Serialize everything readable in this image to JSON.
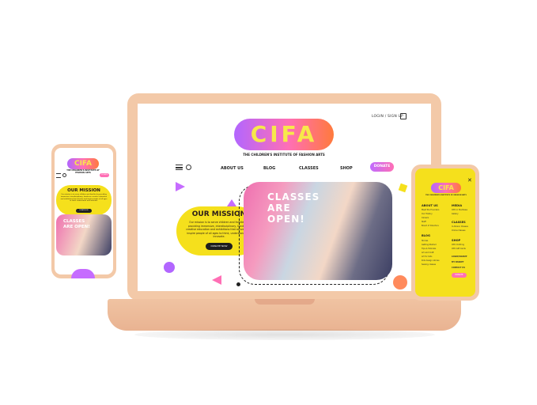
{
  "colors": {
    "accent_yellow": "#f5e01c",
    "accent_pink": "#ff6fb5",
    "accent_purple": "#b266ff",
    "device_peach": "#f3c9a8"
  },
  "brand": {
    "logo": "CIFA",
    "tagline": "THE CHILDREN'S INSTITUTE OF FASHION ARTS"
  },
  "header": {
    "login": "LOGIN / SIGN UP",
    "bag_icon": "bag-icon"
  },
  "nav": {
    "items": [
      {
        "label": "ABOUT US"
      },
      {
        "label": "BLOG"
      },
      {
        "label": "CLASSES"
      },
      {
        "label": "SHOP"
      }
    ],
    "donate": "DONATE",
    "menu_icon": "hamburger-icon",
    "search_icon": "search-icon"
  },
  "mission": {
    "title": "OUR MISSION",
    "body": "Our mission is to serve children and families by providing immersive, interdisciplinary, hands-on, creative education and exhibitions that activate and inspire people of all ages to think, understand, and innovate.",
    "button": "DONATE NOW"
  },
  "hero": {
    "classes_title": "CLASSES ARE OPEN!"
  },
  "mobile_menu": {
    "sections": [
      {
        "title": "ABOUT US",
        "links": [
          "Meet the Founders",
          "Our History",
          "Careers",
          "Staff",
          "Board of Directors"
        ]
      },
      {
        "title": "BLOG",
        "links": [
          "Stories",
          "Getting Started",
          "Tips & Tutorials",
          "Art and Craft",
          "Art for Kids",
          "Kids design stories",
          "Sewing classes"
        ]
      },
      {
        "title": "MEDIA",
        "links": [
          "CIFA in the News",
          "Gallery"
        ]
      },
      {
        "title": "CLASSES",
        "links": [
          "In-Person Classes",
          "Online Classes"
        ]
      },
      {
        "title": "SHOP",
        "links": [
          "CIFA Clothing",
          "CIFA Gift Cards"
        ]
      }
    ],
    "extra": [
      "LOGIN/SIGNUP",
      "MY BASKET",
      "CONTACT US"
    ],
    "donate": "DONATE",
    "close_icon": "close-icon"
  }
}
